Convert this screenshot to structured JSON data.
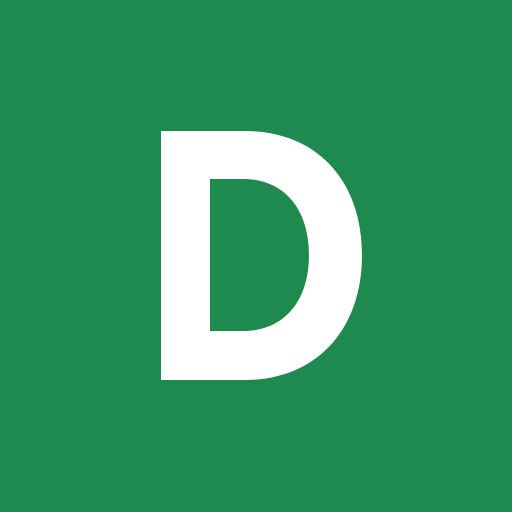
{
  "icon": {
    "letter": "D",
    "background_color": "#1f8a4f",
    "foreground_color": "#ffffff"
  }
}
